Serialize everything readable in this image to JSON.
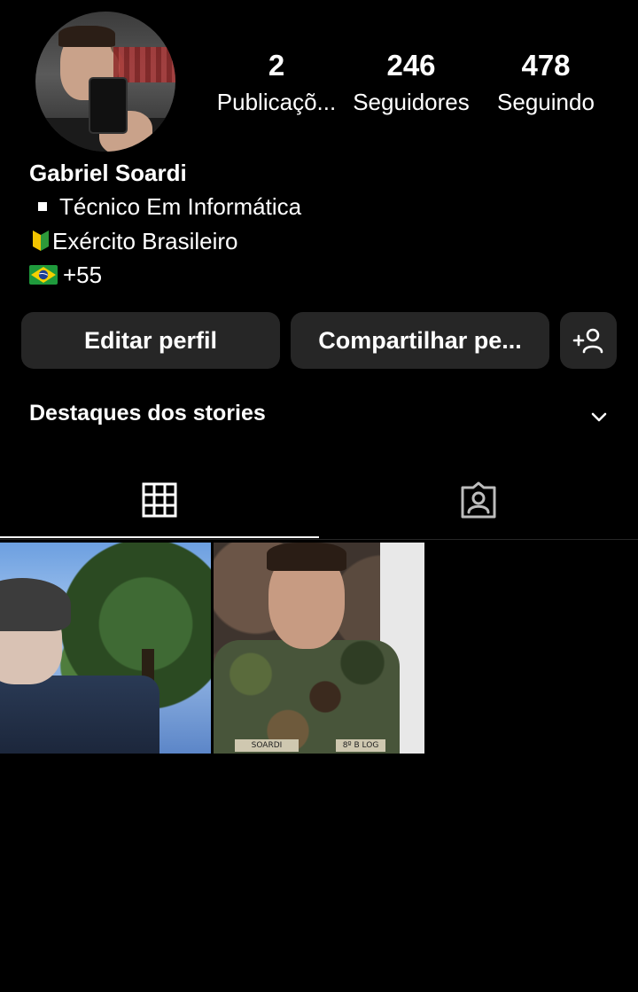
{
  "profile": {
    "name": "Gabriel Soardi",
    "bio": {
      "line1": "Técnico Em Informática",
      "line2": "Exército Brasileiro",
      "line3": "+55"
    }
  },
  "stats": {
    "posts": {
      "value": "2",
      "label": "Publicaçõ..."
    },
    "followers": {
      "value": "246",
      "label": "Seguidores"
    },
    "following": {
      "value": "478",
      "label": "Seguindo"
    }
  },
  "buttons": {
    "edit": "Editar perfil",
    "share": "Compartilhar pe...",
    "add_icon": "add-person-icon"
  },
  "highlights": {
    "title": "Destaques dos stories",
    "toggle_icon": "chevron-down-icon"
  },
  "tabs": [
    {
      "icon": "grid-icon",
      "selected": true
    },
    {
      "icon": "tagged-person-icon",
      "selected": false
    }
  ],
  "posts": {
    "post1": {
      "name_tag": ""
    },
    "post2": {
      "name_tag": "SOARDI",
      "unit_tag": "8º B LOG"
    }
  },
  "colors": {
    "background": "#000000",
    "button_bg": "#262626",
    "text": "#ffffff"
  }
}
